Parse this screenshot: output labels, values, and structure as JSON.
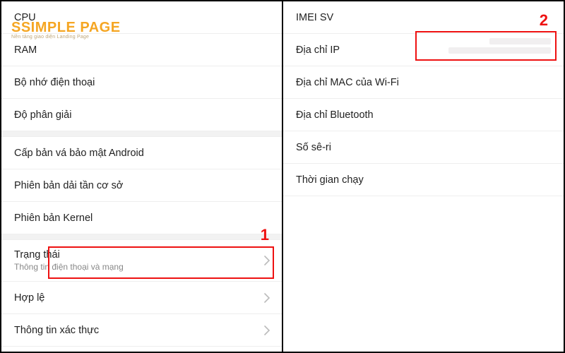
{
  "logo": {
    "brand": "SIMPLE PAGE",
    "tagline": "Nền tảng giao diện Landing Page"
  },
  "left": {
    "items": [
      {
        "label": "CPU"
      },
      {
        "label": "RAM"
      },
      {
        "label": "Bộ nhớ điện thoại"
      },
      {
        "label": "Độ phân giải"
      }
    ],
    "items2": [
      {
        "label": "Cấp bản vá bảo mật Android"
      },
      {
        "label": "Phiên bản dải tần cơ sở"
      },
      {
        "label": "Phiên bản Kernel"
      }
    ],
    "status": {
      "label": "Trạng thái",
      "sub": "Thông tin điện thoại và mạng"
    },
    "items3": [
      {
        "label": "Hợp lệ"
      },
      {
        "label": "Thông tin xác thực"
      }
    ]
  },
  "right": {
    "items": [
      {
        "label": "IMEI SV"
      },
      {
        "label": "Địa chỉ IP"
      },
      {
        "label": "Địa chỉ MAC của Wi-Fi"
      },
      {
        "label": "Địa chỉ Bluetooth"
      },
      {
        "label": "Số sê-ri"
      },
      {
        "label": "Thời gian chạy"
      }
    ]
  },
  "callouts": {
    "one": "1",
    "two": "2"
  }
}
